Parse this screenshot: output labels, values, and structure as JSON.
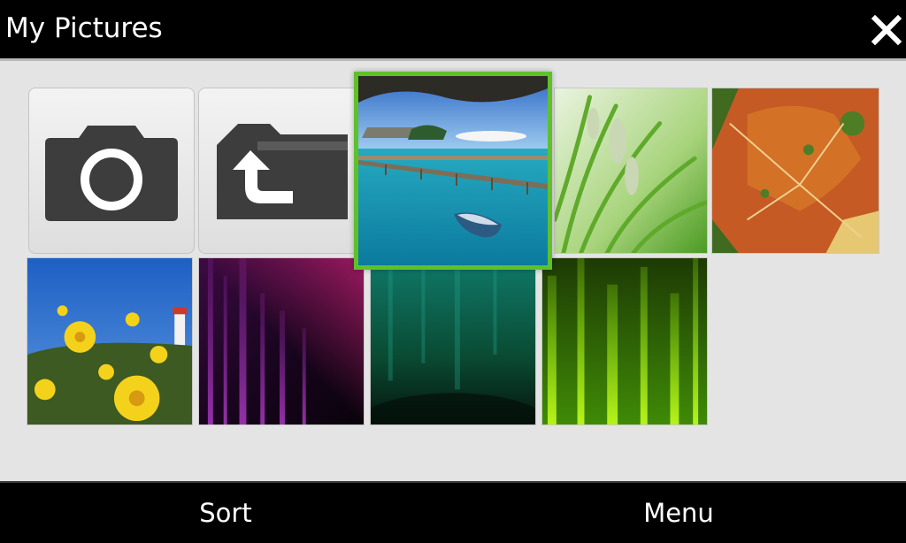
{
  "header": {
    "title": "My Pictures",
    "close_icon": "close-icon"
  },
  "grid": {
    "selected_index": 2,
    "items": [
      {
        "kind": "action",
        "icon": "camera-icon"
      },
      {
        "kind": "action",
        "icon": "folder-up-icon"
      },
      {
        "kind": "thumbnail",
        "subject": "beach-pier"
      },
      {
        "kind": "thumbnail",
        "subject": "grass"
      },
      {
        "kind": "thumbnail",
        "subject": "autumn-leaf"
      },
      {
        "kind": "thumbnail",
        "subject": "yellow-flowers"
      },
      {
        "kind": "thumbnail",
        "subject": "purple-streaks"
      },
      {
        "kind": "thumbnail",
        "subject": "teal-streaks"
      },
      {
        "kind": "thumbnail",
        "subject": "green-streaks"
      }
    ],
    "accent_color": "#5ec12a"
  },
  "softkeys": {
    "left_label": "Sort",
    "right_label": "Menu"
  }
}
